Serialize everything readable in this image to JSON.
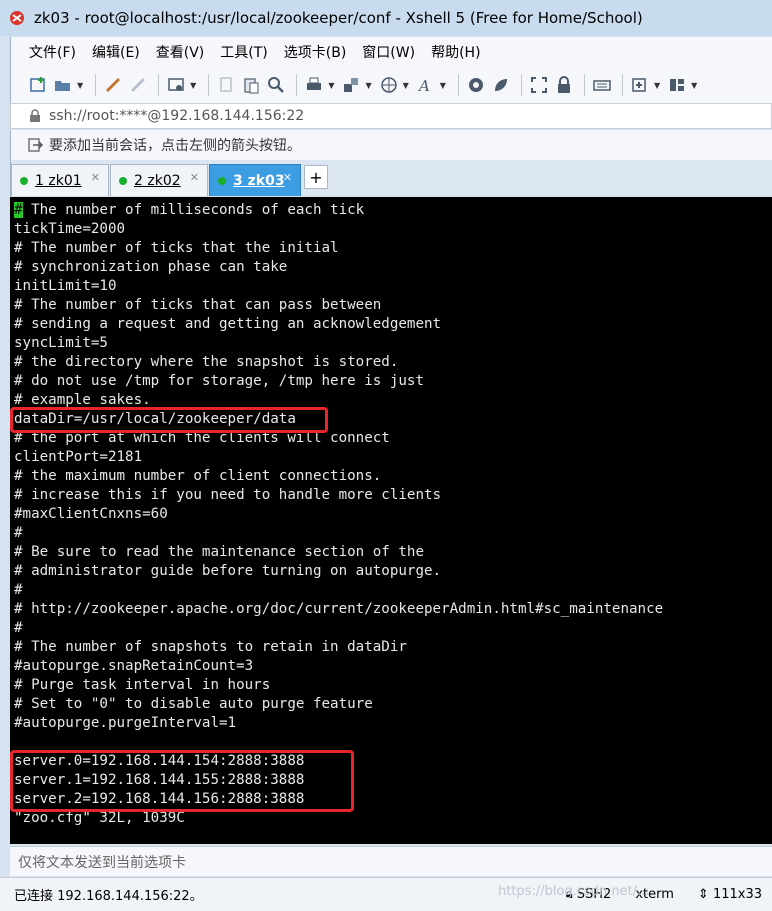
{
  "window": {
    "title": "zk03 - root@localhost:/usr/local/zookeeper/conf - Xshell 5 (Free for Home/School)",
    "icon": "xshell-app-icon"
  },
  "menu": [
    "文件(F)",
    "编辑(E)",
    "查看(V)",
    "工具(T)",
    "选项卡(B)",
    "窗口(W)",
    "帮助(H)"
  ],
  "address": {
    "text": "ssh://root:****@192.168.144.156:22"
  },
  "infobar": {
    "text": "要添加当前会话，点击左侧的箭头按钮。"
  },
  "tabs": [
    {
      "label": "1 zk01",
      "active": false
    },
    {
      "label": "2 zk02",
      "active": false
    },
    {
      "label": "3 zk03",
      "active": true
    }
  ],
  "tab_add_label": "+",
  "terminal": {
    "cursor_char": "#",
    "lines": [
      " The number of milliseconds of each tick",
      "tickTime=2000",
      "# The number of ticks that the initial",
      "# synchronization phase can take",
      "initLimit=10",
      "# The number of ticks that can pass between",
      "# sending a request and getting an acknowledgement",
      "syncLimit=5",
      "# the directory where the snapshot is stored.",
      "# do not use /tmp for storage, /tmp here is just",
      "# example sakes.",
      "dataDir=/usr/local/zookeeper/data",
      "# the port at which the clients will connect",
      "clientPort=2181",
      "# the maximum number of client connections.",
      "# increase this if you need to handle more clients",
      "#maxClientCnxns=60",
      "#",
      "# Be sure to read the maintenance section of the",
      "# administrator guide before turning on autopurge.",
      "#",
      "# http://zookeeper.apache.org/doc/current/zookeeperAdmin.html#sc_maintenance",
      "#",
      "# The number of snapshots to retain in dataDir",
      "#autopurge.snapRetainCount=3",
      "# Purge task interval in hours",
      "# Set to \"0\" to disable auto purge feature",
      "#autopurge.purgeInterval=1",
      "",
      "server.0=192.168.144.154:2888:3888",
      "server.1=192.168.144.155:2888:3888",
      "server.2=192.168.144.156:2888:3888",
      "\"zoo.cfg\" 32L, 1039C"
    ]
  },
  "sendbar": {
    "text": "仅将文本发送到当前选项卡"
  },
  "status": {
    "connection": "已连接 192.168.144.156:22。",
    "protocol": "SSH2",
    "terminal_type": "xterm",
    "size": "111x33"
  },
  "watermark": "https://blog.csdn.net/..."
}
